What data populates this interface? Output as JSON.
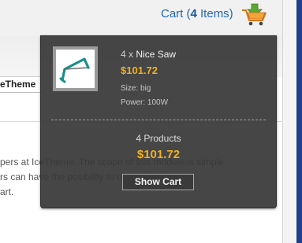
{
  "header": {
    "cart_prefix": "Cart (",
    "cart_count": "4",
    "cart_suffix": " Items)",
    "cart_icon": "shopping-cart-add-icon"
  },
  "nav": {
    "menu_item": "eTheme"
  },
  "content": {
    "lines": [
      "pers at IceTheme. The scope of this module is simple.",
      "rs can have the posibility to use a floating cart",
      "art."
    ]
  },
  "mini_cart": {
    "item": {
      "qty_prefix": "4 x",
      "name": "Nice Saw",
      "price": "$101.72",
      "size": "Size: big",
      "power": "Power: 100W",
      "thumbnail_icon": "saw-icon"
    },
    "summary_count": "4 Products",
    "summary_total": "$101.72",
    "show_cart_label": "Show Cart"
  },
  "colors": {
    "link_blue": "#1e67b6",
    "price_gold": "#f2b01e",
    "dropdown_bg": "#383838",
    "cart_green": "#5aa832"
  }
}
